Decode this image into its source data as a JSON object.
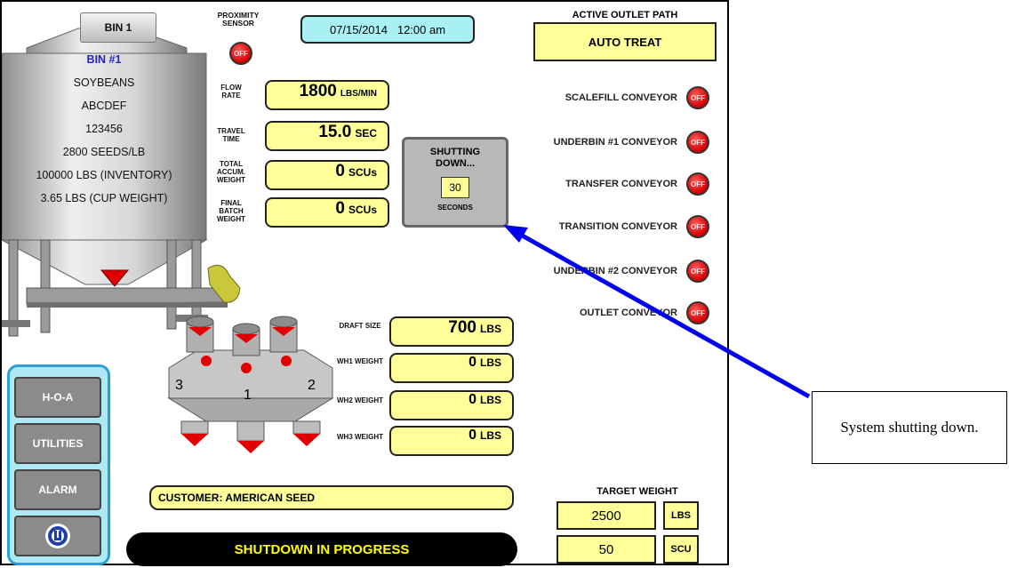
{
  "bin_tab": "BIN 1",
  "proximity": {
    "label": "PROXIMITY SENSOR",
    "state": "OFF"
  },
  "datetime": "07/15/2014   12:00 am",
  "outlet_path": {
    "title": "ACTIVE OUTLET PATH",
    "value": "AUTO TREAT"
  },
  "bin_info": [
    "BIN #1",
    "SOYBEANS",
    "ABCDEF",
    "123456",
    "2800 SEEDS/LB",
    "100000 LBS (INVENTORY)",
    "3.65 LBS (CUP WEIGHT)"
  ],
  "readouts": [
    {
      "label": "FLOW RATE",
      "value": "1800",
      "unit": "LBS/MIN"
    },
    {
      "label": "TRAVEL TIME",
      "value": "15.0",
      "unit": "SEC"
    },
    {
      "label": "TOTAL ACCUM. WEIGHT",
      "value": "0",
      "unit": "SCUs"
    },
    {
      "label": "FINAL BATCH WEIGHT",
      "value": "0",
      "unit": "SCUs"
    }
  ],
  "shutdown": {
    "title": "SHUTTING DOWN...",
    "seconds": "30",
    "unit": "SECONDS"
  },
  "conveyors": [
    {
      "label": "SCALEFILL CONVEYOR",
      "state": "OFF"
    },
    {
      "label": "UNDERBIN #1 CONVEYOR",
      "state": "OFF"
    },
    {
      "label": "TRANSFER CONVEYOR",
      "state": "OFF"
    },
    {
      "label": "TRANSITION CONVEYOR",
      "state": "OFF"
    },
    {
      "label": "UNDERBIN #2 CONVEYOR",
      "state": "OFF"
    },
    {
      "label": "OUTLET CONVEYOR",
      "state": "OFF"
    }
  ],
  "hoppers": {
    "left": "3",
    "center": "1",
    "right": "2"
  },
  "weights": [
    {
      "label": "DRAFT SIZE",
      "value": "700",
      "unit": "LBS"
    },
    {
      "label": "WH1 WEIGHT",
      "value": "0",
      "unit": "LBS"
    },
    {
      "label": "WH2 WEIGHT",
      "value": "0",
      "unit": "LBS"
    },
    {
      "label": "WH3 WEIGHT",
      "value": "0",
      "unit": "LBS"
    }
  ],
  "nav": [
    "H-O-A",
    "UTILITIES",
    "ALARM"
  ],
  "customer": "CUSTOMER: AMERICAN SEED",
  "status": "SHUTDOWN IN PROGRESS",
  "target": {
    "title": "TARGET WEIGHT",
    "lbs_value": "2500",
    "lbs_unit": "LBS",
    "scu_value": "50",
    "scu_unit": "SCU"
  },
  "callout": "System shutting down.",
  "colors": {
    "panel_yellow": "#ffff99",
    "status_text": "#ffff00",
    "arrow": "#0000ee",
    "off_red": "#e00000",
    "bin_text_blue": "#2222cc"
  }
}
